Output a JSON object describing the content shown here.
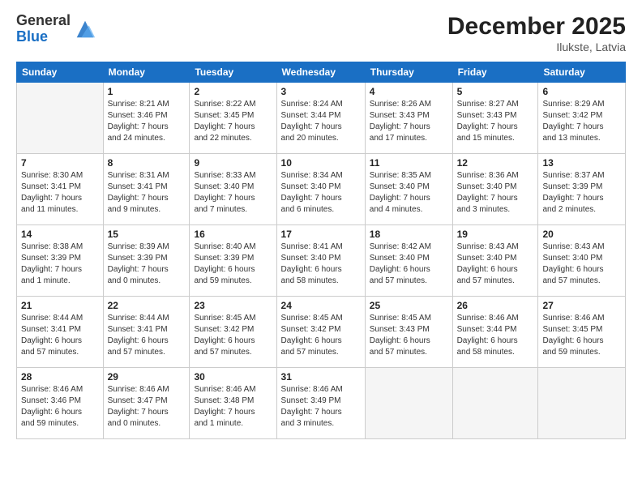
{
  "logo": {
    "general": "General",
    "blue": "Blue"
  },
  "title": "December 2025",
  "subtitle": "Ilukste, Latvia",
  "weekdays": [
    "Sunday",
    "Monday",
    "Tuesday",
    "Wednesday",
    "Thursday",
    "Friday",
    "Saturday"
  ],
  "weeks": [
    [
      {
        "day": "",
        "info": ""
      },
      {
        "day": "1",
        "info": "Sunrise: 8:21 AM\nSunset: 3:46 PM\nDaylight: 7 hours\nand 24 minutes."
      },
      {
        "day": "2",
        "info": "Sunrise: 8:22 AM\nSunset: 3:45 PM\nDaylight: 7 hours\nand 22 minutes."
      },
      {
        "day": "3",
        "info": "Sunrise: 8:24 AM\nSunset: 3:44 PM\nDaylight: 7 hours\nand 20 minutes."
      },
      {
        "day": "4",
        "info": "Sunrise: 8:26 AM\nSunset: 3:43 PM\nDaylight: 7 hours\nand 17 minutes."
      },
      {
        "day": "5",
        "info": "Sunrise: 8:27 AM\nSunset: 3:43 PM\nDaylight: 7 hours\nand 15 minutes."
      },
      {
        "day": "6",
        "info": "Sunrise: 8:29 AM\nSunset: 3:42 PM\nDaylight: 7 hours\nand 13 minutes."
      }
    ],
    [
      {
        "day": "7",
        "info": "Sunrise: 8:30 AM\nSunset: 3:41 PM\nDaylight: 7 hours\nand 11 minutes."
      },
      {
        "day": "8",
        "info": "Sunrise: 8:31 AM\nSunset: 3:41 PM\nDaylight: 7 hours\nand 9 minutes."
      },
      {
        "day": "9",
        "info": "Sunrise: 8:33 AM\nSunset: 3:40 PM\nDaylight: 7 hours\nand 7 minutes."
      },
      {
        "day": "10",
        "info": "Sunrise: 8:34 AM\nSunset: 3:40 PM\nDaylight: 7 hours\nand 6 minutes."
      },
      {
        "day": "11",
        "info": "Sunrise: 8:35 AM\nSunset: 3:40 PM\nDaylight: 7 hours\nand 4 minutes."
      },
      {
        "day": "12",
        "info": "Sunrise: 8:36 AM\nSunset: 3:40 PM\nDaylight: 7 hours\nand 3 minutes."
      },
      {
        "day": "13",
        "info": "Sunrise: 8:37 AM\nSunset: 3:39 PM\nDaylight: 7 hours\nand 2 minutes."
      }
    ],
    [
      {
        "day": "14",
        "info": "Sunrise: 8:38 AM\nSunset: 3:39 PM\nDaylight: 7 hours\nand 1 minute."
      },
      {
        "day": "15",
        "info": "Sunrise: 8:39 AM\nSunset: 3:39 PM\nDaylight: 7 hours\nand 0 minutes."
      },
      {
        "day": "16",
        "info": "Sunrise: 8:40 AM\nSunset: 3:39 PM\nDaylight: 6 hours\nand 59 minutes."
      },
      {
        "day": "17",
        "info": "Sunrise: 8:41 AM\nSunset: 3:40 PM\nDaylight: 6 hours\nand 58 minutes."
      },
      {
        "day": "18",
        "info": "Sunrise: 8:42 AM\nSunset: 3:40 PM\nDaylight: 6 hours\nand 57 minutes."
      },
      {
        "day": "19",
        "info": "Sunrise: 8:43 AM\nSunset: 3:40 PM\nDaylight: 6 hours\nand 57 minutes."
      },
      {
        "day": "20",
        "info": "Sunrise: 8:43 AM\nSunset: 3:40 PM\nDaylight: 6 hours\nand 57 minutes."
      }
    ],
    [
      {
        "day": "21",
        "info": "Sunrise: 8:44 AM\nSunset: 3:41 PM\nDaylight: 6 hours\nand 57 minutes."
      },
      {
        "day": "22",
        "info": "Sunrise: 8:44 AM\nSunset: 3:41 PM\nDaylight: 6 hours\nand 57 minutes."
      },
      {
        "day": "23",
        "info": "Sunrise: 8:45 AM\nSunset: 3:42 PM\nDaylight: 6 hours\nand 57 minutes."
      },
      {
        "day": "24",
        "info": "Sunrise: 8:45 AM\nSunset: 3:42 PM\nDaylight: 6 hours\nand 57 minutes."
      },
      {
        "day": "25",
        "info": "Sunrise: 8:45 AM\nSunset: 3:43 PM\nDaylight: 6 hours\nand 57 minutes."
      },
      {
        "day": "26",
        "info": "Sunrise: 8:46 AM\nSunset: 3:44 PM\nDaylight: 6 hours\nand 58 minutes."
      },
      {
        "day": "27",
        "info": "Sunrise: 8:46 AM\nSunset: 3:45 PM\nDaylight: 6 hours\nand 59 minutes."
      }
    ],
    [
      {
        "day": "28",
        "info": "Sunrise: 8:46 AM\nSunset: 3:46 PM\nDaylight: 6 hours\nand 59 minutes."
      },
      {
        "day": "29",
        "info": "Sunrise: 8:46 AM\nSunset: 3:47 PM\nDaylight: 7 hours\nand 0 minutes."
      },
      {
        "day": "30",
        "info": "Sunrise: 8:46 AM\nSunset: 3:48 PM\nDaylight: 7 hours\nand 1 minute."
      },
      {
        "day": "31",
        "info": "Sunrise: 8:46 AM\nSunset: 3:49 PM\nDaylight: 7 hours\nand 3 minutes."
      },
      {
        "day": "",
        "info": ""
      },
      {
        "day": "",
        "info": ""
      },
      {
        "day": "",
        "info": ""
      }
    ]
  ]
}
